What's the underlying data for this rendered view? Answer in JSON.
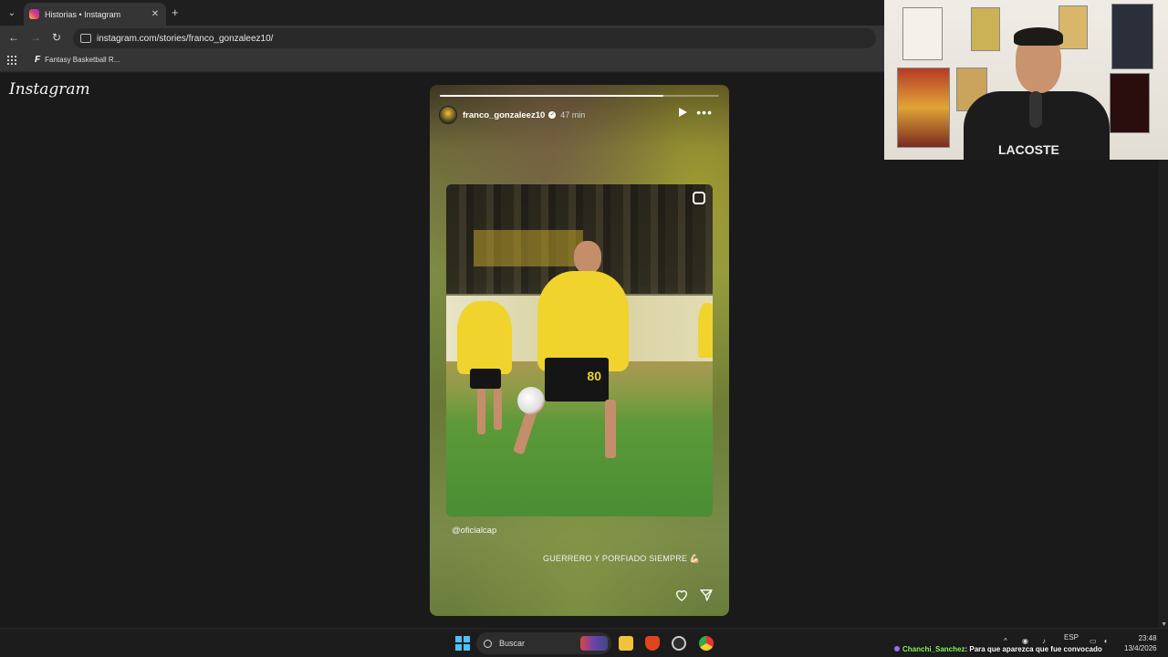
{
  "browser": {
    "tab": {
      "title": "Historias • Instagram",
      "close": "✕"
    },
    "new_tab": "+",
    "tab_menu": "⌄",
    "nav": {
      "back": "←",
      "forward": "→",
      "reload": "↻"
    },
    "url": "instagram.com/stories/franco_gonzaleez10/",
    "bookmarks": [
      {
        "icon": "F",
        "label": "Fantasy Basketball R..."
      }
    ]
  },
  "instagram": {
    "logo": "Instagram",
    "story": {
      "username": "franco_gonzaleez10",
      "verified": true,
      "time": "47 min",
      "progress": 0.8,
      "mention": "@oficialcap",
      "caption": "GUERRERO Y PORFIADO SIEMPRE 💪🏻",
      "jersey_number": "80"
    }
  },
  "webcam": {
    "shirt_text": "LACOSTE"
  },
  "taskbar": {
    "search_placeholder": "Buscar",
    "language": "ESP",
    "time": "23:48",
    "date": "13/4/2026"
  },
  "chat_overlay": {
    "user": "Chanchi_Sanchez",
    "message": ": Para que aparezca que fue convocado"
  },
  "colors": {
    "brand_yellow": "#f0d32c",
    "windows_blue": "#4cc2ff",
    "chat_user": "#8bff5a"
  }
}
